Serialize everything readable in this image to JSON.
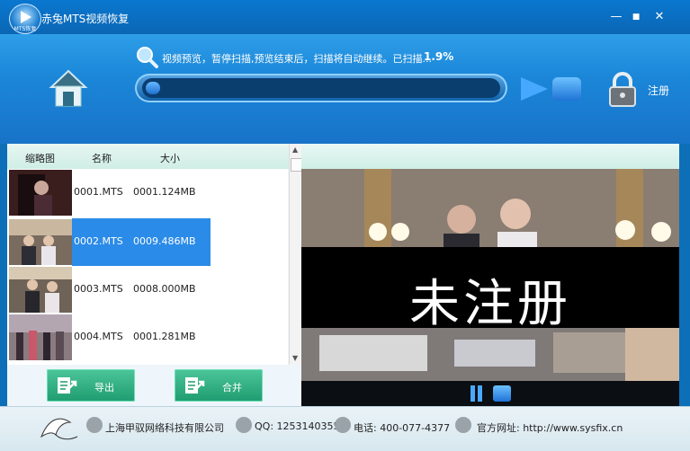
{
  "window": {
    "title": "赤兔MTS视频恢复",
    "logo_label": "MTS恢复",
    "controls": [
      "—",
      "■",
      "✕"
    ]
  },
  "scan": {
    "status_text": "视频预览，暂停扫描,预览结束后，扫描将自动继续。已扫描...",
    "percent_text": "1.9%",
    "progress_fraction": 0.019
  },
  "actions": {
    "register_label": "注册",
    "export_label": "导出",
    "merge_label": "合并"
  },
  "table": {
    "columns": [
      "缩略图",
      "名称",
      "大小"
    ],
    "rows": [
      {
        "name": "0001.MTS",
        "size": "0001.124MB"
      },
      {
        "name": "0002.MTS",
        "size": "0009.486MB"
      },
      {
        "name": "0003.MTS",
        "size": "0008.000MB"
      },
      {
        "name": "0004.MTS",
        "size": "0001.281MB"
      }
    ],
    "selected_index": 1
  },
  "preview": {
    "watermark_text": "未注册"
  },
  "footer": {
    "company": "上海甲驭网络科技有限公司",
    "qq": "QQ: 1253140355",
    "phone": "电话: 400-077-4377",
    "website": "官方网址: http://www.sysfix.cn"
  },
  "colors": {
    "accent": "#2b8be8",
    "button_green": "#2fb081",
    "panel_blue": "#1b86d8"
  }
}
